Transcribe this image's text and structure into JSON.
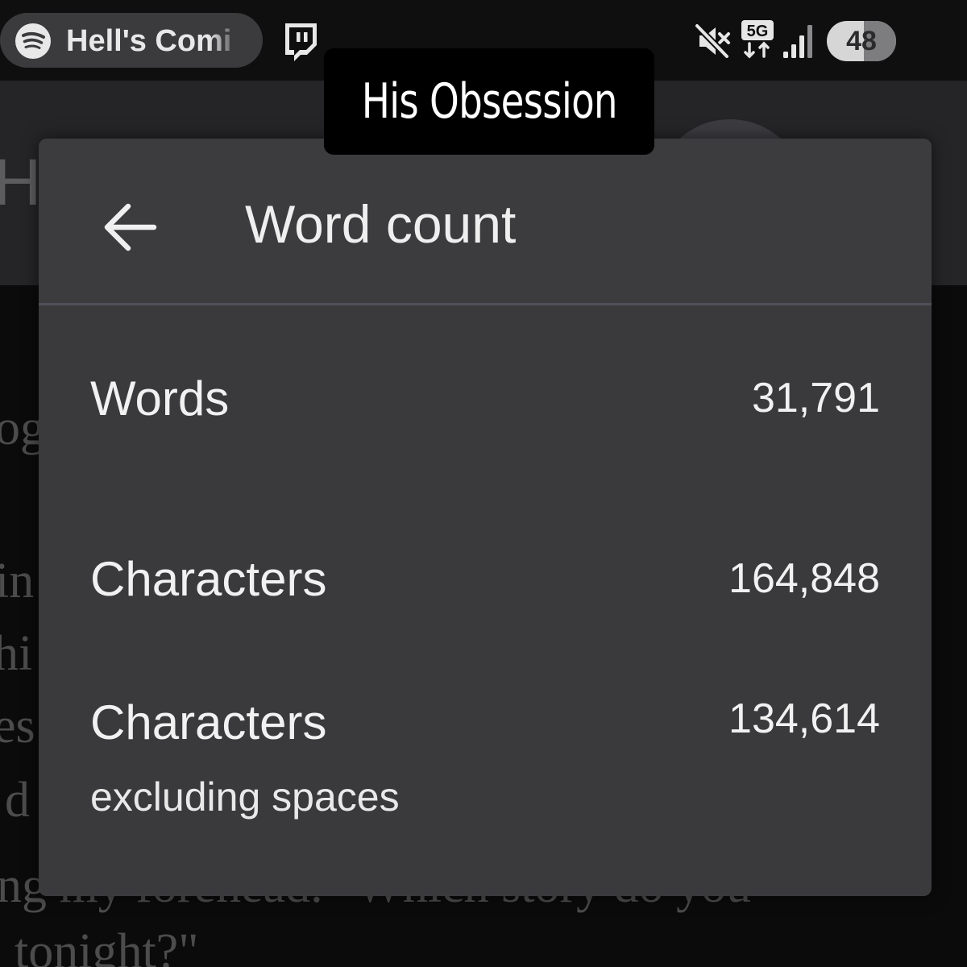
{
  "status_bar": {
    "media_title": "Hell's Comi",
    "battery_level": "48",
    "network_label": "5G",
    "icons": [
      "spotify-icon",
      "twitch-icon",
      "mute-icon",
      "network-5g-icon",
      "signal-icon",
      "battery-icon"
    ]
  },
  "background_app": {
    "title_fragment": "H",
    "text_fragments": [
      "og",
      "in",
      "hi",
      "es",
      "d",
      "ng my forehead. \"Which story do you",
      "tonight?\""
    ]
  },
  "caption": {
    "text": "His Obsession"
  },
  "dialog": {
    "title": "Word count",
    "back_icon": "arrow-back-icon",
    "stats": [
      {
        "label": "Words",
        "sublabel": "",
        "value": "31,791"
      },
      {
        "label": "Characters",
        "sublabel": "",
        "value": "164,848"
      },
      {
        "label": "Characters",
        "sublabel": "excluding spaces",
        "value": "134,614"
      }
    ]
  },
  "colors": {
    "dialog_bg": "#3a3a3d",
    "divider": "#4f5059",
    "text": "#f1f1f1",
    "caption_bg": "#000000"
  }
}
